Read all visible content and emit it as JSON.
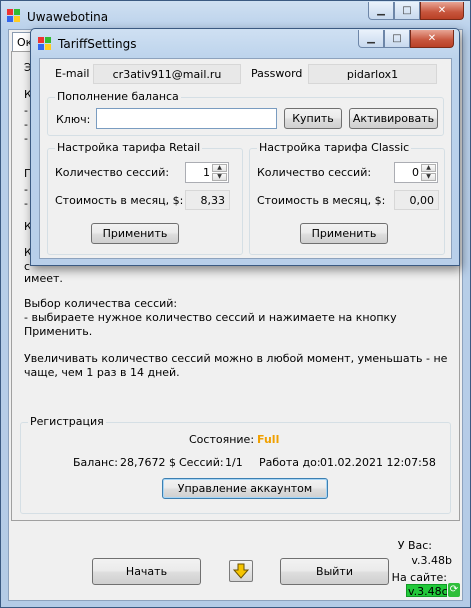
{
  "main_window": {
    "title": "Uwawebotina",
    "tab_label": "Ок",
    "bg_label_1": "Э",
    "bg_label_2": "К",
    "bg_label_3": "-",
    "bg_label_4": "-",
    "bg_label_5": "-",
    "bg_label_6": "П",
    "bg_label_7": "-",
    "bg_label_8": "-",
    "bg_label_9": "К",
    "bg_label_10": "К",
    "bg_label_11": "с",
    "bg_line_1": "имеет.",
    "info_para_1": "Выбор количества сессий:\n- выбираете нужное количество сессий и нажимаете на кнопку Применить.",
    "info_para_2": "Увеличивать количество сессий можно в любой момент, уменьшать - не чаще, чем 1 раз в 14 дней."
  },
  "registration": {
    "caption": "Регистрация",
    "state_label": "Состояние:",
    "state_value": "Full",
    "balance_label": "Баланс:",
    "balance_value": "28,7672 $",
    "sessions_label": "Сессий:",
    "sessions_value": "1/1",
    "work_until_label": "Работа до:",
    "work_until_value": "01.02.2021 12:07:58",
    "manage_button": "Управление аккаунтом"
  },
  "bottom": {
    "start_button": "Начать",
    "exit_button": "Выйти",
    "your_version_label": "У Вас:",
    "your_version": "v.3.48b",
    "site_label": "На сайте:",
    "site_version": "v.3.48c"
  },
  "dialog": {
    "title": "TariffSettings",
    "email_label": "E-mail",
    "email_value": "cr3ativ911@mail.ru",
    "password_label": "Password",
    "password_value": "pidarlox1",
    "topup": {
      "caption": "Пополнение баланса",
      "key_label": "Ключ:",
      "key_value": "",
      "buy_button": "Купить",
      "activate_button": "Активировать"
    },
    "retail": {
      "caption": "Настройка тарифа Retail",
      "sessions_label": "Количество сессий:",
      "sessions_value": "1",
      "cost_label": "Стоимость в месяц, $:",
      "cost_value": "8,33",
      "apply_button": "Применить"
    },
    "classic": {
      "caption": "Настройка тарифа Classic",
      "sessions_label": "Количество сессий:",
      "sessions_value": "0",
      "cost_label": "Стоимость в месяц, $:",
      "cost_value": "0,00",
      "apply_button": "Применить"
    }
  },
  "icons": {
    "app_icon": "colored-squares-icon",
    "arrow": "down-arrow-icon",
    "refresh": "refresh-icon"
  },
  "colors": {
    "state_full": "#f0a000",
    "site_version_bg": "#22c93a"
  }
}
